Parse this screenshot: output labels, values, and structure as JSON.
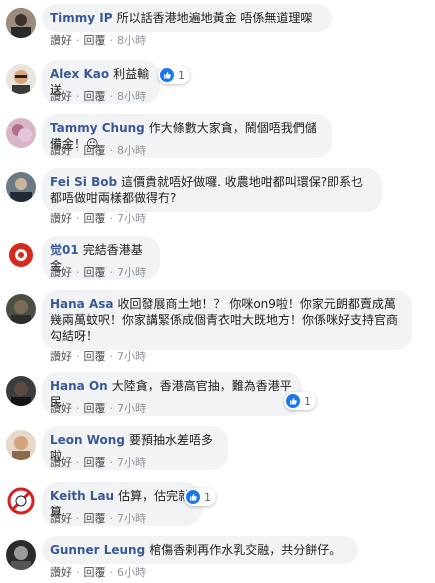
{
  "comments": [
    {
      "author": "Timmy IP",
      "text": "所以話香港地遍地黃金 唔係無道理㗎",
      "reply": "讚好",
      "respond": "回覆",
      "time": "8小時"
    },
    {
      "author": "Alex Kao",
      "text": "利益輸送",
      "reply": "讚好",
      "respond": "回覆",
      "time": "8小時",
      "reactions": "1"
    },
    {
      "author": "Tammy Chung",
      "text": "作大條數大家貪，鬧個唔我們儲備金！😐",
      "reply": "讚好",
      "respond": "回覆",
      "time": "8小時"
    },
    {
      "author": "Fei Si Bob",
      "text": "這價貴就唔好做囉. 收農地咁都叫環保?即系乜都唔做咁兩樣都做得冇?",
      "reply": "讚好",
      "respond": "回覆",
      "time": "7小時"
    },
    {
      "author": "觉01",
      "text": "完結香港基金",
      "reply": "讚好",
      "respond": "回覆",
      "time": "7小時"
    },
    {
      "author": "Hana Asa",
      "text": "收回發展商土地！？ 你咪on9啦！你家元朗都賣成萬幾兩萬蚊呎！你家講緊係成個青衣咁大既地方！你係咪好支持官商勾結呀！",
      "reply": "讚好",
      "respond": "回覆",
      "time": "7小時"
    },
    {
      "author": "Hana On",
      "text": "大陸貪，香港高官抽，難為香港平民",
      "reply": "讚好",
      "respond": "回覆",
      "time": "7小時",
      "reactions": "1"
    },
    {
      "author": "Leon Wong",
      "text": "要預抽水差唔多啦",
      "reply": "讚好",
      "respond": "回覆",
      "time": "7小時"
    },
    {
      "author": "Keith Lau",
      "text": "估算，估完就算",
      "reply": "讚好",
      "respond": "回覆",
      "time": "7小時",
      "reactions": "1"
    },
    {
      "author": "Gunner Leung",
      "text": "棺傷香剌再作水乳交融，共分餅仔。",
      "reply": "讚好",
      "respond": "回覆",
      "time": "6小時"
    }
  ]
}
